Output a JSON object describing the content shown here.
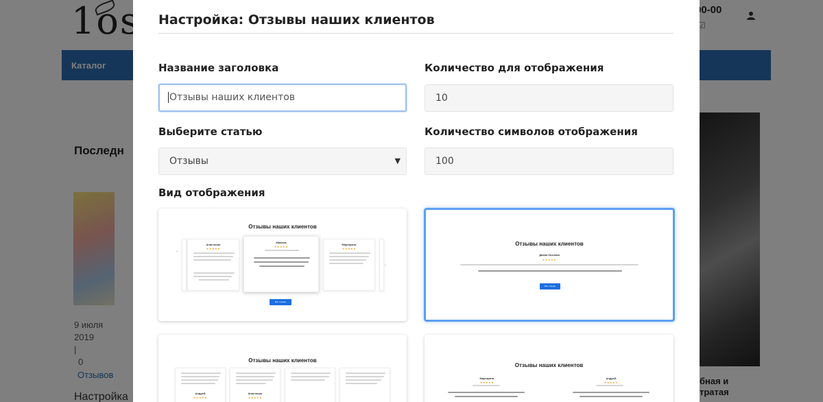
{
  "background": {
    "logo": "1os",
    "phone": "00-00",
    "phone_sub": "☑",
    "nav": {
      "catalog": "Каталог"
    },
    "section_title": "Последн",
    "post": {
      "date": "9 июля 2019",
      "separator": "|",
      "count": "0",
      "reviews_link": "Отзывов"
    },
    "bottom_left": "Настройка",
    "bottom_right": "бная и тратая"
  },
  "modal": {
    "title": "Настройка: Отзывы наших клиентов",
    "heading_name": {
      "label": "Название заголовка",
      "value": "Отзывы наших клиентов"
    },
    "display_count": {
      "label": "Количество для отображения",
      "value": "10"
    },
    "article": {
      "label": "Выберите статью",
      "selected": "Отзывы"
    },
    "chars_count": {
      "label": "Количество символов отображения",
      "value": "100"
    },
    "view_label": "Вид отображения",
    "layouts": [
      {
        "title": "Отзывы наших клиентов",
        "selected": false,
        "left_name": "Анастасия",
        "center_name": "Максим",
        "right_name": "Маргарита",
        "button": "Все отзывы"
      },
      {
        "title": "Отзывы наших клиентов",
        "selected": true,
        "name": "Диана Козлова",
        "button": "Все отзывы"
      },
      {
        "title": "Отзывы наших клиентов",
        "selected": false,
        "names": [
          "Андрей",
          "Анастасия"
        ]
      },
      {
        "title": "Отзывы наших клиентов",
        "selected": false,
        "names": [
          "Маргарита",
          "Андрей"
        ]
      }
    ],
    "stars": "★★★★★"
  },
  "colors": {
    "overlay": "#000000",
    "nav_bar": "#2b6cb0",
    "selected_border": "#5a9ff0",
    "mini_button": "#1e6fe0",
    "stars": "#f0a020"
  }
}
